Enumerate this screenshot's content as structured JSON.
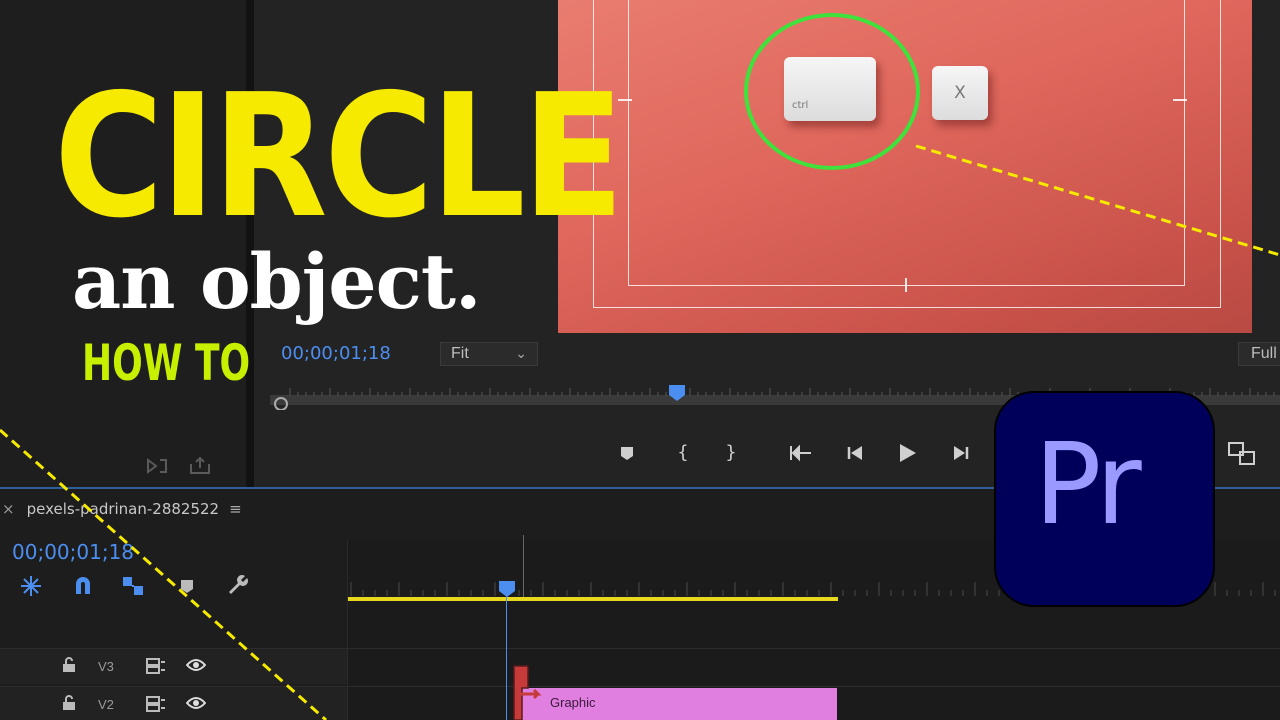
{
  "monitor": {
    "timecode": "00;00;01;18",
    "fit_select": "Fit",
    "full_select": "Full",
    "key_ctrl_label": "ctrl",
    "key_x_label": "X"
  },
  "transport": {
    "icons": [
      "add-marker-icon",
      "mark-in-icon",
      "mark-out-icon",
      "go-to-in-icon",
      "step-back-icon",
      "play-icon",
      "step-forward-icon",
      "multi-camera-icon"
    ]
  },
  "sequence": {
    "close_glyph": "×",
    "name": "pexels-padrinan-2882522",
    "menu_glyph": "≡",
    "timecode": "00;00;01;18"
  },
  "tracks": [
    {
      "name": "V3"
    },
    {
      "name": "V2"
    }
  ],
  "clip": {
    "label": "Graphic",
    "color": "#e07fe0"
  },
  "overlay": {
    "title_main": "CIRCLE",
    "title_sub": "an object.",
    "title_howto": "HOW TO",
    "logo_text": "Pr"
  },
  "colors": {
    "accent_blue": "#4c8ef0",
    "title_yellow": "#f5ea00",
    "howto_green": "#c7f000",
    "circle_green": "#3fe23a",
    "logo_bg": "#00005b",
    "logo_text": "#9999ff",
    "workarea_yellow": "#e8d81e"
  }
}
